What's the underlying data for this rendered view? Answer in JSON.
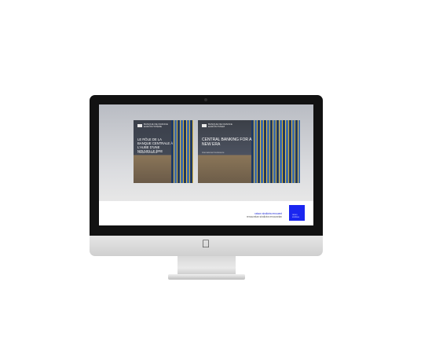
{
  "slides": [
    {
      "id": "fr",
      "logo_text": "BANQUE DE FRANCE\nEUROSYSTÈME",
      "title": "LE RÔLE DE LA BANQUE CENTRALE À L'AUBE D'UNE NOUVELLE ÈRE",
      "subtitle": "Colloque international"
    },
    {
      "id": "en",
      "logo_text": "BANQUE DE FRANCE\nEUROSYSTEM",
      "title": "CENTRAL BANKING for a NEW ERA",
      "subtitle": "International Conference"
    }
  ],
  "footer": {
    "line1": "raison sindicéa renouent",
    "line2": "renouvelan sindicéa renouvelan",
    "badge_text": "raison\nsindicéa"
  },
  "colors": {
    "accent_blue": "#1a26f0",
    "bezel": "#121212"
  },
  "icons": {
    "apple": "apple-logo-icon"
  }
}
